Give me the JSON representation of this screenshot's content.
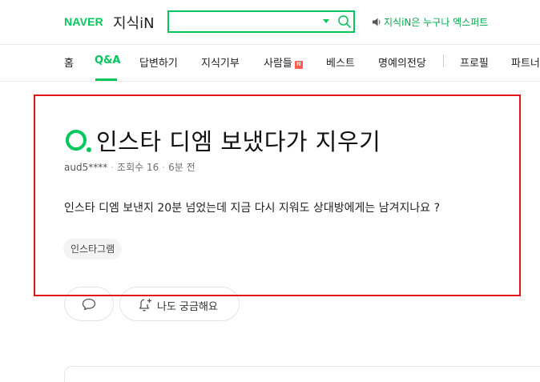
{
  "header": {
    "logo_naver": "NAVER",
    "logo_jisik": "지식iN",
    "search": {
      "value": "",
      "placeholder": ""
    },
    "promo_text": "지식iN은 누구나 엑스퍼트"
  },
  "nav": {
    "items": [
      {
        "label": "홈"
      },
      {
        "label": "Q&A",
        "active": true
      },
      {
        "label": "답변하기"
      },
      {
        "label": "지식기부"
      },
      {
        "label": "사람들",
        "badge": "N"
      },
      {
        "label": "베스트"
      },
      {
        "label": "명예의전당"
      },
      {
        "label": "프로필"
      },
      {
        "label": "파트너"
      }
    ]
  },
  "question": {
    "q_mark": "Q.",
    "title": "인스타 디엠 보냈다가 지우기",
    "author": "aud5****",
    "views_label": "조회수 16",
    "time": "6분 전",
    "body": "인스타 디엠 보낸지 20분 넘었는데 지금 다시 지워도 상대방에게는 남겨지나요 ?",
    "tag": "인스타그램"
  },
  "actions": {
    "wonder_label": "나도 궁금해요"
  },
  "colors": {
    "brand": "#03c75a",
    "highlight": "#e3161b",
    "badge": "#ff5a4e"
  },
  "icons": {
    "search": "search-icon",
    "dropdown": "chevron-down-icon",
    "speaker": "speaker-icon",
    "comment": "comment-icon",
    "bell": "bell-plus-icon"
  }
}
